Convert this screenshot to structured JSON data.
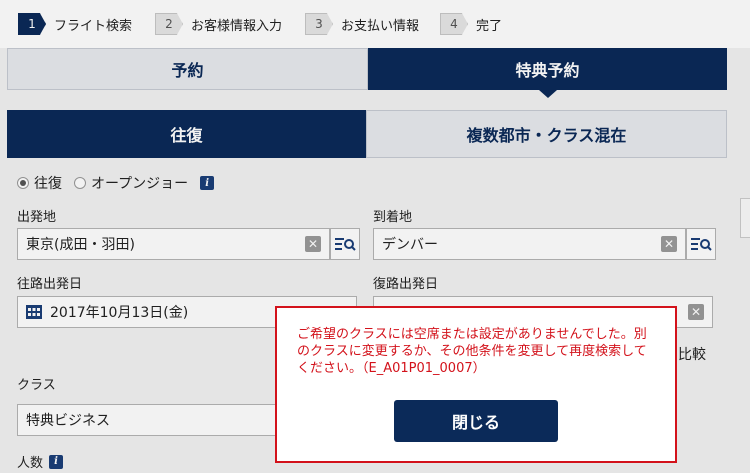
{
  "steps": [
    {
      "num": "1",
      "label": "フライト検索"
    },
    {
      "num": "2",
      "label": "お客様情報入力"
    },
    {
      "num": "3",
      "label": "お支払い情報"
    },
    {
      "num": "4",
      "label": "完了"
    }
  ],
  "booking_tabs": {
    "reservation": "予約",
    "award": "特典予約"
  },
  "trip_tabs": {
    "round_trip": "往復",
    "multi_city": "複数都市・クラス混在"
  },
  "trip_type": {
    "round_trip": "往復",
    "open_jaw": "オープンジョー",
    "selected": "往復"
  },
  "departure": {
    "label": "出発地",
    "value": "東京(成田・羽田)"
  },
  "arrival": {
    "label": "到着地",
    "value": "デンバー"
  },
  "outbound_date": {
    "label": "往路出発日",
    "value": "2017年10月13日(金)"
  },
  "return_date": {
    "label": "復路出発日"
  },
  "compare_text": "比較",
  "class_field": {
    "label": "クラス",
    "value": "特典ビジネス"
  },
  "passengers": {
    "label": "人数"
  },
  "modal": {
    "message": "ご希望のクラスには空席または設定がありませんでした。別のクラスに変更するか、その他条件を変更して再度検索してください。（E_A01P01_0007）",
    "close_label": "閉じる",
    "border_color": "#d3121b"
  },
  "colors": {
    "brand": "#0b2a59",
    "error": "#d3121b"
  }
}
